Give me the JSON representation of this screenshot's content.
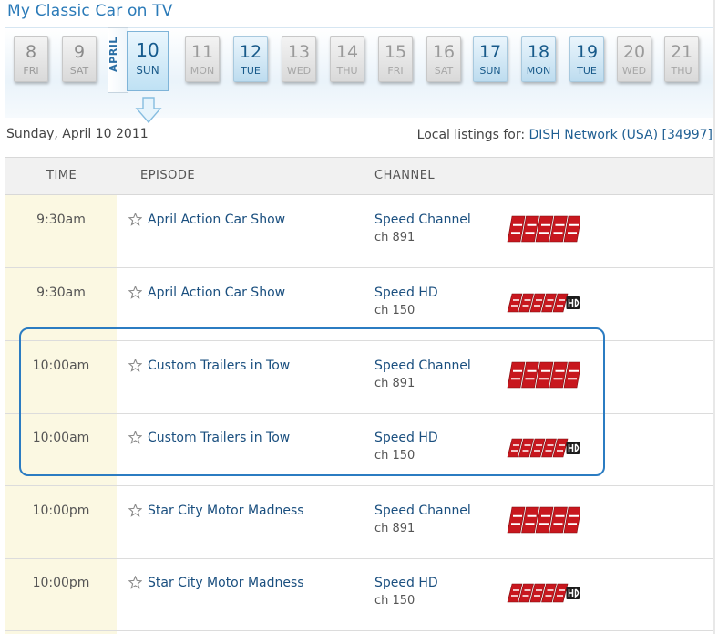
{
  "page": {
    "title": "My Classic Car on TV"
  },
  "calendar": {
    "month_label": "APRIL",
    "selected": {
      "num": "10",
      "weekday": "SUN"
    },
    "days": [
      {
        "num": "8",
        "weekday": "FRI",
        "state": "past"
      },
      {
        "num": "9",
        "weekday": "SAT",
        "state": "past"
      },
      {
        "num": "11",
        "weekday": "MON",
        "state": "none"
      },
      {
        "num": "12",
        "weekday": "TUE",
        "state": "avail"
      },
      {
        "num": "13",
        "weekday": "WED",
        "state": "none"
      },
      {
        "num": "14",
        "weekday": "THU",
        "state": "none"
      },
      {
        "num": "15",
        "weekday": "FRI",
        "state": "none"
      },
      {
        "num": "16",
        "weekday": "SAT",
        "state": "none"
      },
      {
        "num": "17",
        "weekday": "SUN",
        "state": "avail"
      },
      {
        "num": "18",
        "weekday": "MON",
        "state": "avail"
      },
      {
        "num": "19",
        "weekday": "TUE",
        "state": "avail"
      },
      {
        "num": "20",
        "weekday": "WED",
        "state": "none"
      },
      {
        "num": "21",
        "weekday": "THU",
        "state": "none"
      }
    ]
  },
  "listing": {
    "date_text": "Sunday, April 10 2011",
    "local_prefix": "Local listings for:",
    "provider": "DISH Network (USA) [34997]"
  },
  "table": {
    "headers": {
      "time": "TIME",
      "episode": "EPISODE",
      "channel": "CHANNEL"
    },
    "rows": [
      {
        "time": "9:30am",
        "episode": "April Action Car Show",
        "channel": "Speed Channel",
        "ch": "ch 891",
        "logo": "speed"
      },
      {
        "time": "9:30am",
        "episode": "April Action Car Show",
        "channel": "Speed HD",
        "ch": "ch 150",
        "logo": "speed-hd"
      },
      {
        "time": "10:00am",
        "episode": "Custom Trailers in Tow",
        "channel": "Speed Channel",
        "ch": "ch 891",
        "logo": "speed"
      },
      {
        "time": "10:00am",
        "episode": "Custom Trailers in Tow",
        "channel": "Speed HD",
        "ch": "ch 150",
        "logo": "speed-hd"
      },
      {
        "time": "10:00pm",
        "episode": "Star City Motor Madness",
        "channel": "Speed Channel",
        "ch": "ch 891",
        "logo": "speed"
      },
      {
        "time": "10:00pm",
        "episode": "Star City Motor Madness",
        "channel": "Speed HD",
        "ch": "ch 150",
        "logo": "speed-hd"
      }
    ]
  },
  "colors": {
    "accent": "#2a7ab8",
    "highlight": "#2b7cc2",
    "time_column": "#fbf8e2",
    "logo_red": "#c8171e"
  }
}
